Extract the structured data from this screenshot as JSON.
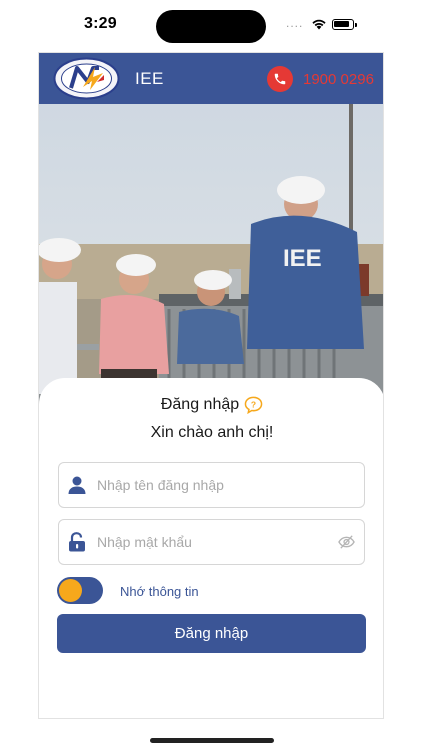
{
  "status_bar": {
    "time": "3:29",
    "dots": "....",
    "icons": [
      "wifi-icon",
      "battery-icon"
    ]
  },
  "header": {
    "app_name": "IEE",
    "hotline": "1900 0296",
    "logo_icon": "company-logo",
    "phone_icon": "phone-icon"
  },
  "hero": {
    "shirt_text": "IEE"
  },
  "login": {
    "title": "Đăng nhập",
    "greeting": "Xin chào anh chị!",
    "username_placeholder": "Nhập tên đăng nhập",
    "password_placeholder": "Nhập mật khẩu",
    "remember_label": "Nhớ thông tin",
    "remember_on": true,
    "submit_label": "Đăng nhập"
  },
  "colors": {
    "primary": "#3b5596",
    "accent": "#f6a81c",
    "hotline": "#e53935"
  }
}
